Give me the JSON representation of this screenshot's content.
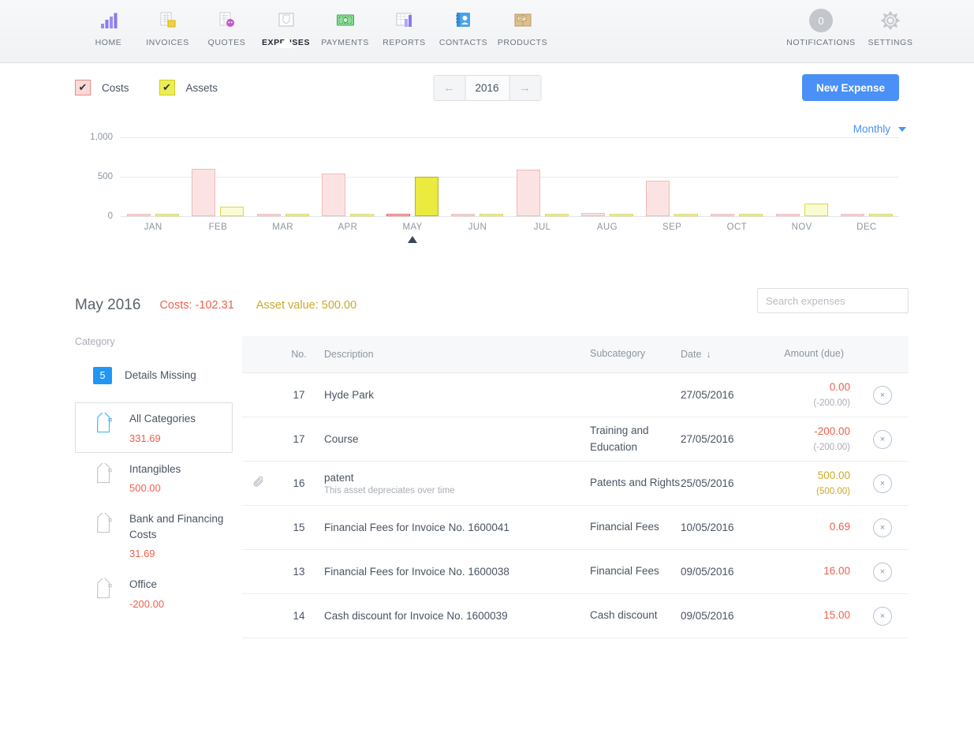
{
  "nav": {
    "left_items": [
      {
        "label": "HOME",
        "icon": "bar-chart-icon",
        "active": false
      },
      {
        "label": "INVOICES",
        "icon": "invoice-icon",
        "active": false
      },
      {
        "label": "QUOTES",
        "icon": "quote-icon",
        "active": false
      },
      {
        "label": "EXPENSES",
        "icon": "expense-icon",
        "active": true
      },
      {
        "label": "PAYMENTS",
        "icon": "banknote-icon",
        "active": false
      },
      {
        "label": "REPORTS",
        "icon": "report-icon",
        "active": false
      },
      {
        "label": "CONTACTS",
        "icon": "contacts-icon",
        "active": false
      },
      {
        "label": "PRODUCTS",
        "icon": "products-box-icon",
        "active": false
      }
    ],
    "right_items": [
      {
        "label": "NOTIFICATIONS",
        "icon": "notification-badge-icon",
        "count": "0"
      },
      {
        "label": "SETTINGS",
        "icon": "gear-icon"
      }
    ]
  },
  "filters": {
    "costs_label": "Costs",
    "costs_checked": true,
    "assets_label": "Assets",
    "assets_checked": true,
    "check_glyph": "✔"
  },
  "year_picker": {
    "prev": "←",
    "year": "2016",
    "next": "→"
  },
  "new_expense_label": "New Expense",
  "granularity": {
    "label": "Monthly"
  },
  "chart_data": {
    "type": "bar",
    "title": "",
    "xlabel": "",
    "ylabel": "",
    "ylim": [
      0,
      1000
    ],
    "yticks": [
      "1,000",
      "500",
      "0"
    ],
    "ytick_values": [
      1000,
      500,
      0
    ],
    "grid": true,
    "legend_position": "top-left",
    "selected_category": "MAY",
    "categories": [
      "JAN",
      "FEB",
      "MAR",
      "APR",
      "MAY",
      "JUN",
      "JUL",
      "AUG",
      "SEP",
      "OCT",
      "NOV",
      "DEC"
    ],
    "series": [
      {
        "name": "Costs",
        "color": "#fbe3e3",
        "values": [
          20,
          600,
          20,
          545,
          20,
          20,
          590,
          45,
          450,
          20,
          22,
          20
        ]
      },
      {
        "name": "Assets",
        "color": "#eded55",
        "values": [
          20,
          120,
          20,
          20,
          500,
          20,
          20,
          20,
          20,
          20,
          160,
          20
        ]
      }
    ]
  },
  "summary": {
    "period": "May 2016",
    "costs": "Costs: -102.31",
    "asset_value": "Asset value: 500.00"
  },
  "search": {
    "placeholder": "Search expenses",
    "value": ""
  },
  "categories": {
    "title": "Category",
    "details_missing": {
      "count": "5",
      "label": "Details Missing"
    },
    "items": [
      {
        "name": "All Categories",
        "amount": "331.69",
        "selected": true
      },
      {
        "name": "Intangibles",
        "amount": "500.00",
        "selected": false
      },
      {
        "name": "Bank and Financing Costs",
        "amount": "31.69",
        "selected": false
      },
      {
        "name": "Office",
        "amount": "-200.00",
        "selected": false
      }
    ]
  },
  "table": {
    "headers": {
      "no": "No.",
      "description": "Description",
      "subcategory": "Subcategory",
      "date": "Date",
      "date_sort": "↓",
      "amount": "Amount (due)"
    },
    "rows": [
      {
        "attachment": false,
        "no": "17",
        "description": "Hyde Park",
        "desc_sub": "",
        "subcategory": "",
        "date": "27/05/2016",
        "amount": "0.00",
        "amount_color": "red",
        "amount_due": "(-200.00)",
        "due_color": "grey",
        "delete": "×"
      },
      {
        "attachment": false,
        "no": "17",
        "description": "Course",
        "desc_sub": "",
        "subcategory": "Training and Education",
        "date": "27/05/2016",
        "amount": "-200.00",
        "amount_color": "red",
        "amount_due": "(-200.00)",
        "due_color": "grey",
        "delete": "×"
      },
      {
        "attachment": true,
        "no": "16",
        "description": "patent",
        "desc_sub": "This asset depreciates over time",
        "subcategory": "Patents and Rights",
        "date": "25/05/2016",
        "amount": "500.00",
        "amount_color": "gold",
        "amount_due": "(500.00)",
        "due_color": "gold",
        "delete": "×"
      },
      {
        "attachment": false,
        "no": "15",
        "description": "Financial Fees for Invoice No. 1600041",
        "desc_sub": "",
        "subcategory": "Financial Fees",
        "date": "10/05/2016",
        "amount": "0.69",
        "amount_color": "red",
        "amount_due": "",
        "due_color": "grey",
        "delete": "×"
      },
      {
        "attachment": false,
        "no": "13",
        "description": "Financial Fees for Invoice No. 1600038",
        "desc_sub": "",
        "subcategory": "Financial Fees",
        "date": "09/05/2016",
        "amount": "16.00",
        "amount_color": "red",
        "amount_due": "",
        "due_color": "grey",
        "delete": "×"
      },
      {
        "attachment": false,
        "no": "14",
        "description": "Cash discount for Invoice No. 1600039",
        "desc_sub": "",
        "subcategory": "Cash discount",
        "date": "09/05/2016",
        "amount": "15.00",
        "amount_color": "red",
        "amount_due": "",
        "due_color": "grey",
        "delete": "×"
      }
    ]
  },
  "colors": {
    "accent": "#4a90f7",
    "cost": "#f0604d",
    "asset": "#c9aa28",
    "badge": "#2196f3"
  }
}
